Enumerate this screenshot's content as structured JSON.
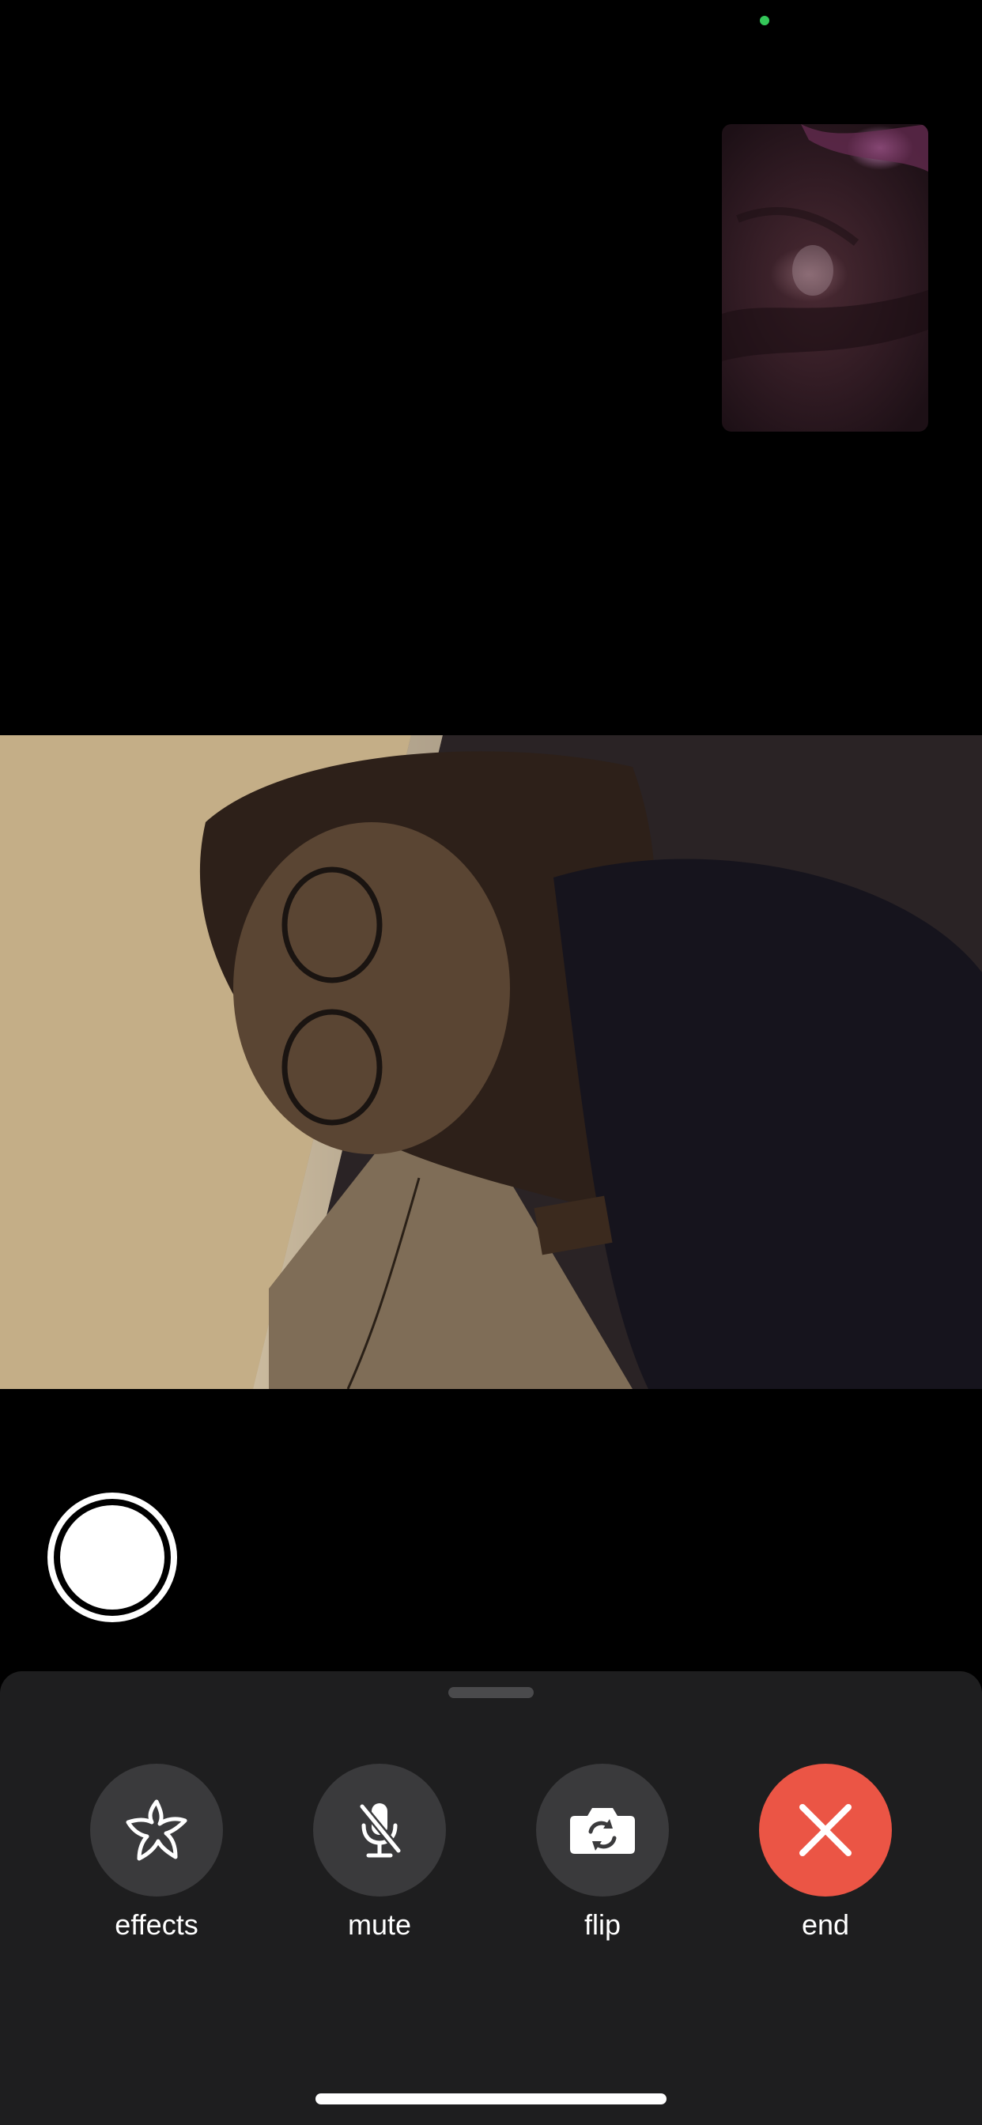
{
  "status": {
    "indicator_color": "#34c759"
  },
  "controls": {
    "effects": {
      "label": "effects",
      "icon": "star-effects-icon"
    },
    "mute": {
      "label": "mute",
      "icon": "microphone-slash-icon"
    },
    "flip": {
      "label": "flip",
      "icon": "camera-rotate-icon"
    },
    "end": {
      "label": "end",
      "icon": "x-mark-icon",
      "color": "#eb5545"
    }
  },
  "colors": {
    "background": "#000000",
    "sheet": "#1e1e1f",
    "button": "#3a3a3c",
    "end_button": "#eb5545"
  }
}
